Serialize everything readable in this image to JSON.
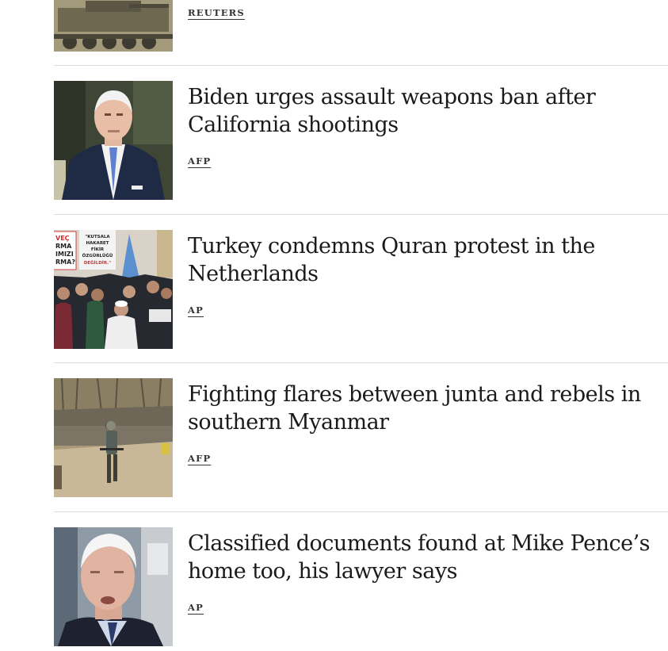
{
  "feed": {
    "items": [
      {
        "headline": "",
        "source": "REUTERS"
      },
      {
        "headline": "Biden urges assault weapons ban after California shootings",
        "source": "AFP"
      },
      {
        "headline": "Turkey condemns Quran protest in the Netherlands",
        "source": "AP"
      },
      {
        "headline": "Fighting flares between junta and rebels in southern Myanmar",
        "source": "AFP"
      },
      {
        "headline": "Classified documents found at Mike Pence’s home too, his lawyer says",
        "source": "AP"
      }
    ]
  },
  "protest_signs": {
    "sign_left": [
      "VEÇ",
      "RMA",
      "IMIZI",
      "RMA?"
    ],
    "sign_right": [
      "\"KUTSALA",
      "HAKARET",
      "FİKİR",
      "ÖZGÜRLÜĞÜ",
      "DEĞİLDİR.\""
    ]
  },
  "colors": {
    "headline": "#1a1a1a",
    "source": "#333333",
    "divider": "#dcdcdc",
    "background": "#ffffff"
  }
}
